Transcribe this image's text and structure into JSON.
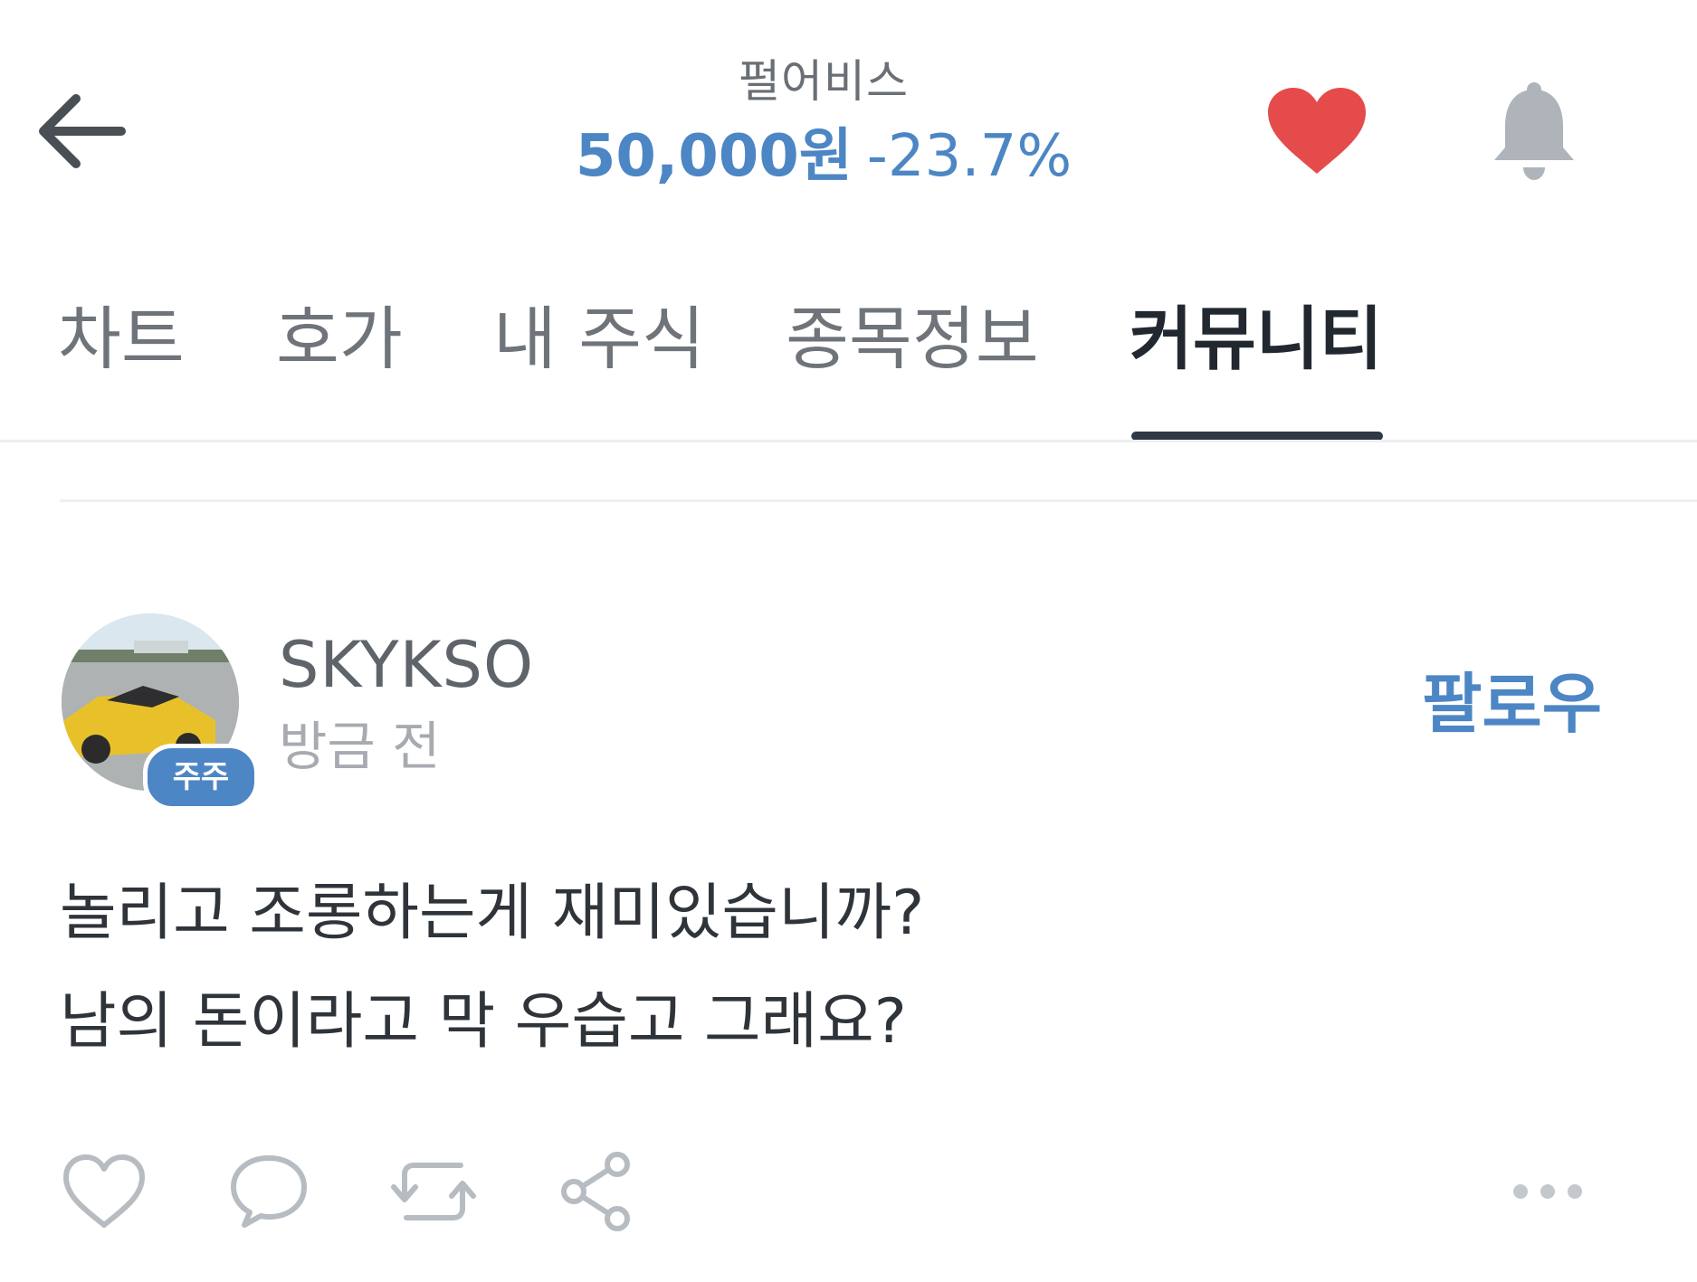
{
  "header": {
    "back_icon": "arrow-left-icon",
    "stock_name": "펄어비스",
    "price": "50,000원",
    "change": "-23.7%",
    "favorite_icon": "heart-filled-icon",
    "favorite_color": "#e54b4b",
    "notification_icon": "bell-icon"
  },
  "tabs": [
    {
      "label": "차트",
      "active": false
    },
    {
      "label": "호가",
      "active": false
    },
    {
      "label": "내 주식",
      "active": false
    },
    {
      "label": "종목정보",
      "active": false
    },
    {
      "label": "커뮤니티",
      "active": true
    }
  ],
  "post": {
    "username": "SKYKSO",
    "badge": "주주",
    "time": "방금 전",
    "follow_label": "팔로우",
    "lines": [
      "놀리고 조롱하는게 재미있습니까?",
      "남의 돈이라고 막 우습고 그래요?"
    ],
    "actions": {
      "like_icon": "heart-outline-icon",
      "comment_icon": "comment-bubble-icon",
      "repost_icon": "repost-icon",
      "share_icon": "share-icon",
      "more_icon": "more-dots-icon"
    }
  },
  "colors": {
    "accent": "#4d86c4",
    "tab_active": "#222830",
    "tab_inactive": "#6f747b"
  }
}
